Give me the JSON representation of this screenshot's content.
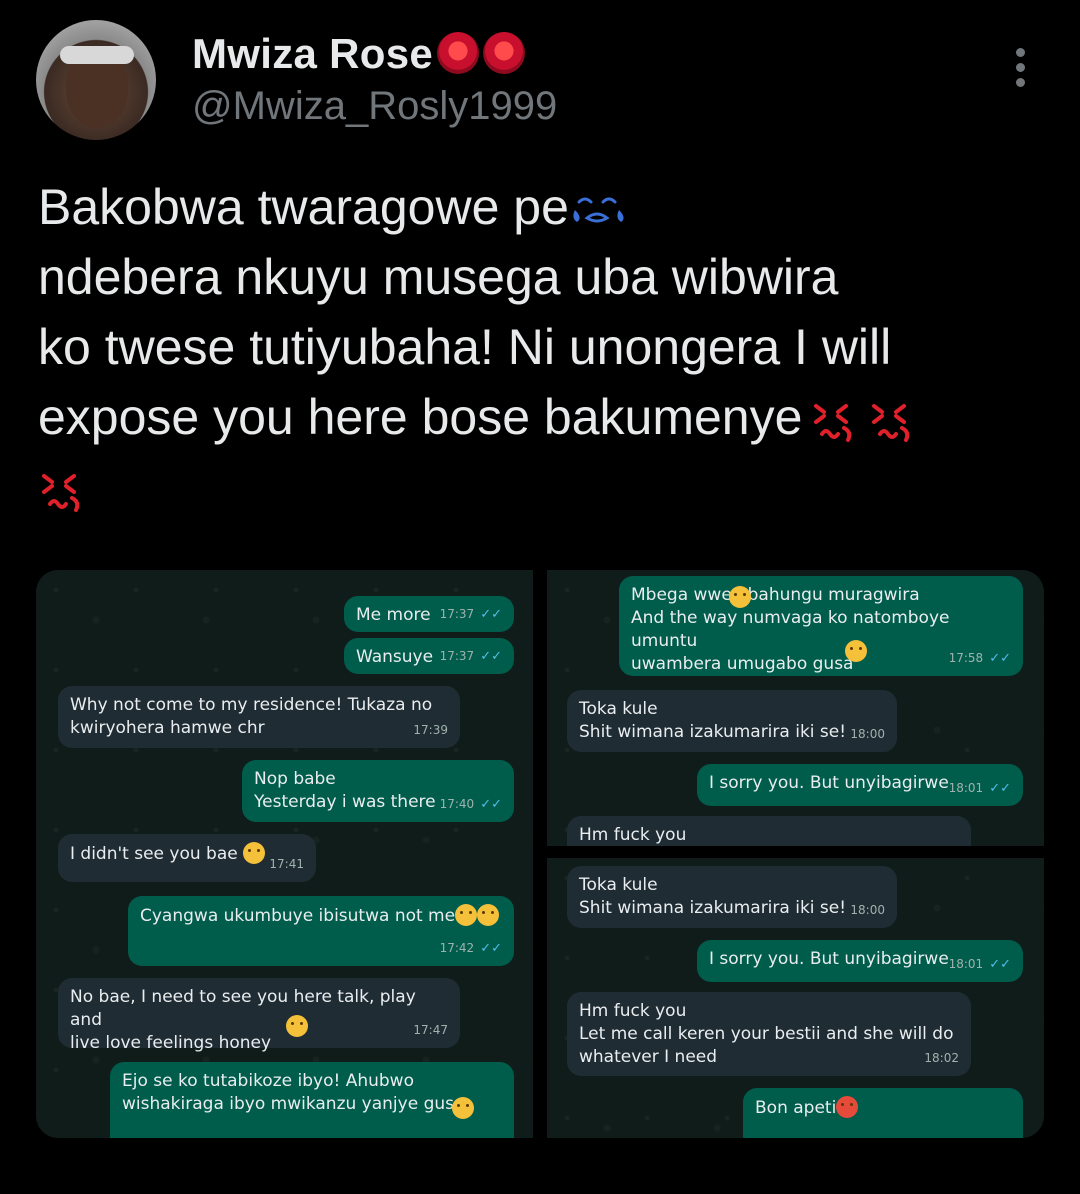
{
  "profile": {
    "name": "Mwiza Rose",
    "handle": "@Mwiza_Rosly1999",
    "name_emoji": [
      "rose-icon",
      "rose-icon"
    ]
  },
  "tweet": {
    "lines": [
      "Bakobwa twaragowe pe",
      "ndebera nkuyu musega uba wibwira",
      "ko twese tutiyubaha! Ni unongera I will",
      "expose you here bose bakumenye"
    ],
    "emoji": [
      "weary-crying-face-icon",
      "angry-face-icon",
      "angry-face-icon",
      "angry-face-icon"
    ]
  },
  "chat_left": {
    "messages": [
      {
        "dir": "out",
        "text": "Me more",
        "time": "17:37"
      },
      {
        "dir": "out",
        "text": "Wansuye",
        "time": "17:37"
      },
      {
        "dir": "in",
        "text": "Why not come to my residence! Tukaza no\nkwiryohera hamwe chr",
        "time": "17:39"
      },
      {
        "dir": "out",
        "text": "Nop babe\nYesterday i was there",
        "time": "17:40"
      },
      {
        "dir": "in",
        "text": "I didn't see you bae",
        "time": "17:41"
      },
      {
        "dir": "out",
        "text": "Cyangwa ukumbuye ibisutwa not me",
        "time": "17:42"
      },
      {
        "dir": "in",
        "text": "No bae, I need to see you here talk, play and\nlive love feelings honey",
        "time": "17:47"
      },
      {
        "dir": "out",
        "text": "Ejo se ko tutabikoze ibyo! Ahubwo\nwishakiraga ibyo mwikanzu yanjye gusa",
        "time": ""
      }
    ]
  },
  "chat_right_top": {
    "messages": [
      {
        "dir": "out",
        "text": "Mbega wwe    abahungu muragwira\nAnd the way numvaga ko natomboye umuntu\nuwambera umugabo gusa",
        "time": "17:58"
      },
      {
        "dir": "in",
        "text": "Toka kule\nShit wimana izakumarira iki se!",
        "time": "18:00"
      },
      {
        "dir": "out",
        "text": "I sorry you. But unyibagirwe",
        "time": "18:01"
      },
      {
        "dir": "in",
        "text": "Hm fuck you",
        "time": ""
      }
    ]
  },
  "chat_right_bottom": {
    "messages": [
      {
        "dir": "in",
        "text": "Toka kule\nShit wimana izakumarira iki se!",
        "time": "18:00"
      },
      {
        "dir": "out",
        "text": "I sorry you. But unyibagirwe",
        "time": "18:01"
      },
      {
        "dir": "in",
        "text": "Hm fuck you\nLet me call keren your bestii and she will do\nwhatever I need",
        "time": "18:02"
      },
      {
        "dir": "out",
        "text": "Bon apeti",
        "time": ""
      }
    ]
  },
  "colors": {
    "background": "#000000",
    "bubble_in": "#1f2c33",
    "bubble_out": "#005c4b",
    "read_ticks": "#53bdeb"
  }
}
